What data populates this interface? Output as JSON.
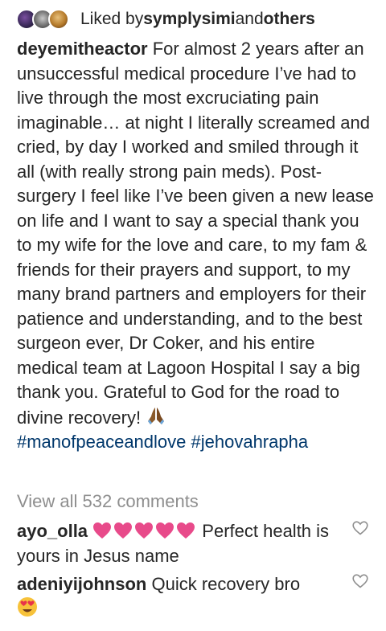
{
  "likes": {
    "prefix": "Liked by ",
    "user": "symplysimi",
    "middle": " and ",
    "others": "others"
  },
  "caption": {
    "username": "deyemitheactor",
    "text": " For almost 2 years after an unsuccessful medical procedure I’ve had to live through the most excruciating pain imaginable… at night I literally screamed and cried, by day I worked and smiled through it all (with really strong pain meds). Post-surgery I feel like I’ve been given a new lease on life and I want to say a special thank you to my wife for the love and care, to my fam & friends for their prayers and support, to my many brand partners and employers for their patience and understanding, and to the best surgeon ever, Dr Coker, and his entire medical team at Lagoon Hospital I say a big thank you. Grateful to God for the road to divine recovery! ",
    "hashtags": "#manofpeaceandlove #jehovahrapha"
  },
  "view_all_comments": "View all 532 comments",
  "comments": [
    {
      "username": "ayo_olla",
      "text": " Perfect health is yours in Jesus name",
      "emoji": "pink-heart-icon x5"
    },
    {
      "username": "adeniyijohnson",
      "text": " Quick recovery bro",
      "emoji": "heart-eyes-icon"
    }
  ],
  "icons": {
    "praying_hands": "praying-hands-icon",
    "like": "heart-outline-icon"
  },
  "colors": {
    "text": "#262626",
    "muted": "#8e8e8e",
    "hashtag": "#00376b",
    "pink_heart": "#e84a8a"
  }
}
